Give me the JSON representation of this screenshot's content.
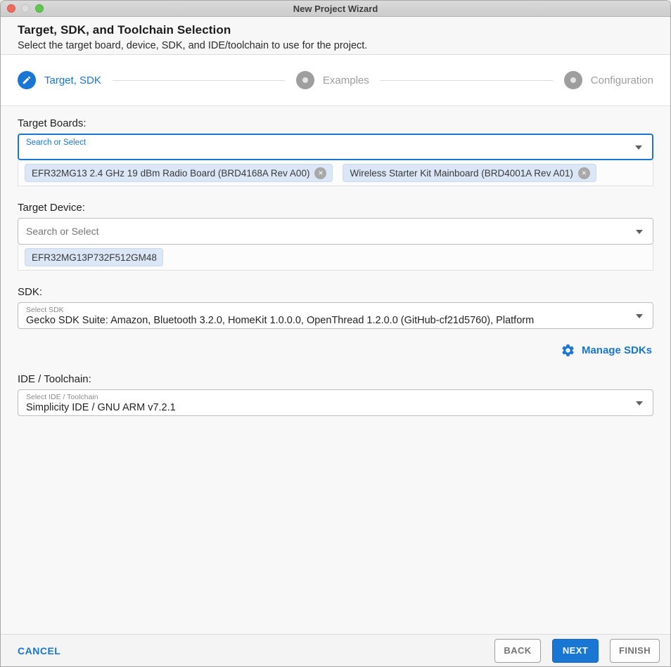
{
  "window": {
    "title": "New Project Wizard"
  },
  "header": {
    "title": "Target, SDK, and Toolchain Selection",
    "subtitle": "Select the target board, device, SDK, and IDE/toolchain to use for the project."
  },
  "stepper": {
    "steps": [
      {
        "label": "Target, SDK",
        "state": "active",
        "icon": "pencil-icon"
      },
      {
        "label": "Examples",
        "state": "pending",
        "icon": "dot-icon"
      },
      {
        "label": "Configuration",
        "state": "pending",
        "icon": "dot-icon"
      }
    ]
  },
  "sections": {
    "target_boards": {
      "label": "Target Boards:",
      "placeholder": "Search or Select",
      "chips": [
        {
          "label": "EFR32MG13 2.4 GHz 19 dBm Radio Board (BRD4168A Rev A00)",
          "removable": true
        },
        {
          "label": "Wireless Starter Kit Mainboard (BRD4001A Rev A01)",
          "removable": true
        }
      ]
    },
    "target_device": {
      "label": "Target Device:",
      "placeholder": "Search or Select",
      "chips": [
        {
          "label": "EFR32MG13P732F512GM48",
          "removable": false
        }
      ]
    },
    "sdk": {
      "label": "SDK:",
      "select_label": "Select SDK",
      "value": "Gecko SDK Suite: Amazon, Bluetooth 3.2.0, HomeKit 1.0.0.0, OpenThread 1.2.0.0 (GitHub-cf21d5760), Platform",
      "manage_label": "Manage SDKs"
    },
    "ide_toolchain": {
      "label": "IDE / Toolchain:",
      "select_label": "Select IDE / Toolchain",
      "value": "Simplicity IDE / GNU ARM v7.2.1"
    }
  },
  "footer": {
    "cancel": "CANCEL",
    "back": "BACK",
    "next": "NEXT",
    "finish": "FINISH"
  },
  "icons": {
    "close_glyph": "×"
  },
  "colors": {
    "accent": "#1976d2",
    "pending": "#9e9e9e",
    "tl-close": "#ee6a5f",
    "tl-min": "#dddddd",
    "tl-zoom": "#61c554"
  }
}
